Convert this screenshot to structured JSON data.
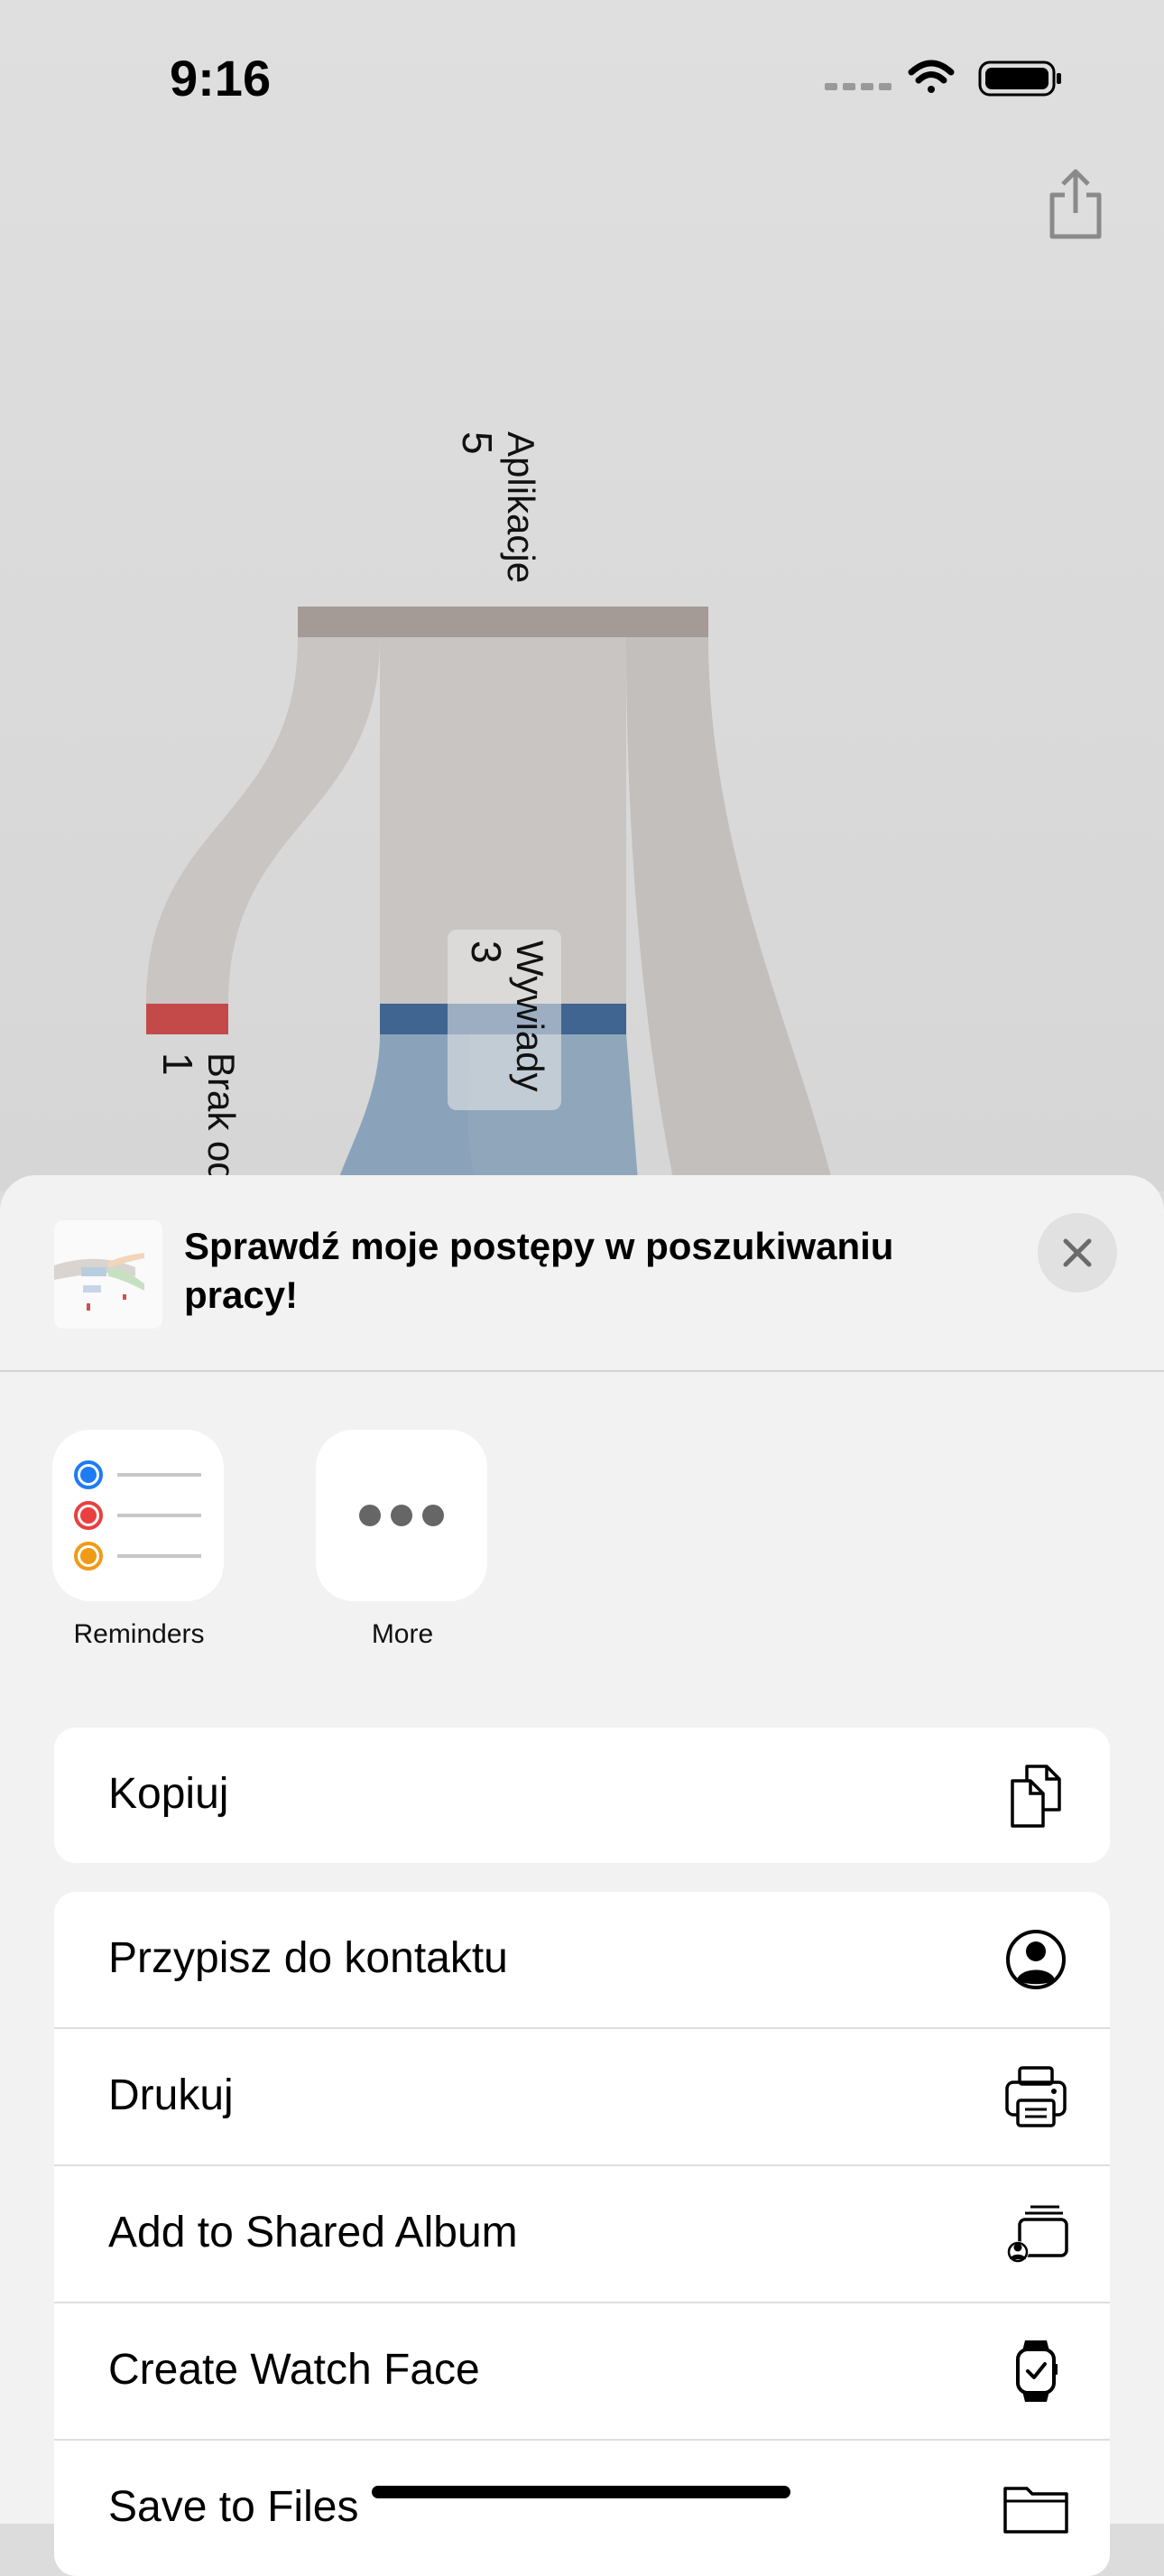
{
  "status_bar": {
    "time": "9:16"
  },
  "chart_data": {
    "type": "sankey",
    "nodes": [
      {
        "name": "Aplikacje",
        "value": 5,
        "color": "#a49b97"
      },
      {
        "name": "Wywiady",
        "value": 3,
        "color": "#3f6590"
      },
      {
        "name": "Brak od",
        "value": 1,
        "color": "#c44a4a"
      }
    ],
    "links": [
      {
        "source": "Aplikacje",
        "target": "Brak od",
        "value": 1
      },
      {
        "source": "Aplikacje",
        "target": "Wywiady",
        "value": 3
      }
    ]
  },
  "sheet": {
    "title": "Sprawdź moje postępy w poszukiwaniu pracy!",
    "apps": [
      {
        "label": "Reminders",
        "icon": "reminders-icon"
      },
      {
        "label": "More",
        "icon": "more-icon"
      }
    ],
    "actions_group1": [
      {
        "label": "Kopiuj",
        "icon": "copy-icon"
      }
    ],
    "actions_group2": [
      {
        "label": "Przypisz do kontaktu",
        "icon": "contact-icon"
      },
      {
        "label": "Drukuj",
        "icon": "printer-icon"
      },
      {
        "label": "Add to Shared Album",
        "icon": "shared-album-icon"
      },
      {
        "label": "Create Watch Face",
        "icon": "watch-icon"
      },
      {
        "label": "Save to Files",
        "icon": "folder-icon"
      }
    ]
  }
}
